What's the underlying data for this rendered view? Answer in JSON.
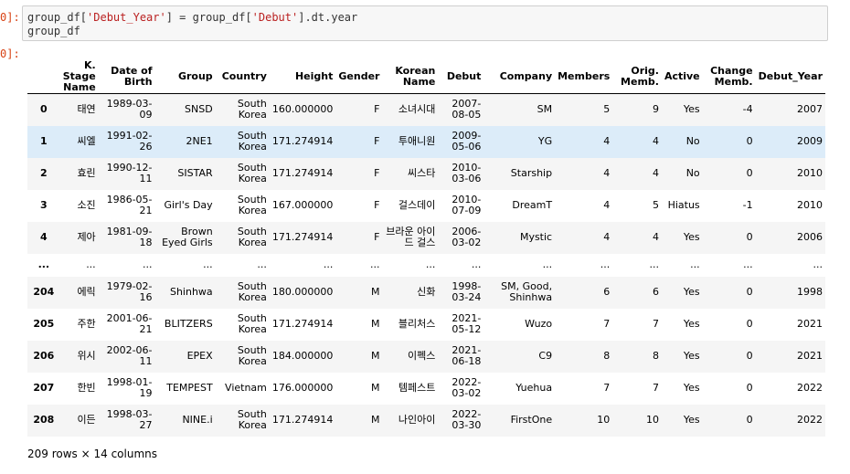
{
  "prompts": {
    "input": "0]:",
    "output": "0]:"
  },
  "code": {
    "line1": {
      "a": "group_df[",
      "s1": "'Debut_Year'",
      "b": "] = group_df[",
      "s2": "'Debut'",
      "c": "].dt.year"
    },
    "line2": "group_df"
  },
  "table": {
    "columns": [
      "",
      "K. Stage Name",
      "Date of Birth",
      "Group",
      "Country",
      "Height",
      "Gender",
      "Korean Name",
      "Debut",
      "Company",
      "Members",
      "Orig. Memb.",
      "Active",
      "Change Memb.",
      "Debut_Year"
    ],
    "rows": [
      [
        "0",
        "태연",
        "1989-03-09",
        "SNSD",
        "South Korea",
        "160.000000",
        "F",
        "소녀시대",
        "2007-08-05",
        "SM",
        "5",
        "9",
        "Yes",
        "-4",
        "2007"
      ],
      [
        "1",
        "씨엘",
        "1991-02-26",
        "2NE1",
        "South Korea",
        "171.274914",
        "F",
        "투애니원",
        "2009-05-06",
        "YG",
        "4",
        "4",
        "No",
        "0",
        "2009"
      ],
      [
        "2",
        "효린",
        "1990-12-11",
        "SISTAR",
        "South Korea",
        "171.274914",
        "F",
        "씨스타",
        "2010-03-06",
        "Starship",
        "4",
        "4",
        "No",
        "0",
        "2010"
      ],
      [
        "3",
        "소진",
        "1986-05-21",
        "Girl's Day",
        "South Korea",
        "167.000000",
        "F",
        "걸스데이",
        "2010-07-09",
        "DreamT",
        "4",
        "5",
        "Hiatus",
        "-1",
        "2010"
      ],
      [
        "4",
        "제아",
        "1981-09-18",
        "Brown Eyed Girls",
        "South Korea",
        "171.274914",
        "F",
        "브라운 아이드 걸스",
        "2006-03-02",
        "Mystic",
        "4",
        "4",
        "Yes",
        "0",
        "2006"
      ],
      [
        "...",
        "...",
        "...",
        "...",
        "...",
        "...",
        "...",
        "...",
        "...",
        "...",
        "...",
        "...",
        "...",
        "...",
        "..."
      ],
      [
        "204",
        "에릭",
        "1979-02-16",
        "Shinhwa",
        "South Korea",
        "180.000000",
        "M",
        "신화",
        "1998-03-24",
        "SM, Good, Shinhwa",
        "6",
        "6",
        "Yes",
        "0",
        "1998"
      ],
      [
        "205",
        "주한",
        "2001-06-21",
        "BLITZERS",
        "South Korea",
        "171.274914",
        "M",
        "블리처스",
        "2021-05-12",
        "Wuzo",
        "7",
        "7",
        "Yes",
        "0",
        "2021"
      ],
      [
        "206",
        "위시",
        "2002-06-11",
        "EPEX",
        "South Korea",
        "184.000000",
        "M",
        "이펙스",
        "2021-06-18",
        "C9",
        "8",
        "8",
        "Yes",
        "0",
        "2021"
      ],
      [
        "207",
        "한빈",
        "1998-01-19",
        "TEMPEST",
        "Vietnam",
        "176.000000",
        "M",
        "템페스트",
        "2022-03-02",
        "Yuehua",
        "7",
        "7",
        "Yes",
        "0",
        "2022"
      ],
      [
        "208",
        "이든",
        "1998-03-27",
        "NINE.i",
        "South Korea",
        "171.274914",
        "M",
        "나인아이",
        "2022-03-30",
        "FirstOne",
        "10",
        "10",
        "Yes",
        "0",
        "2022"
      ]
    ],
    "highlighted_row": 1
  },
  "footer": "209 rows × 14 columns",
  "colors": {
    "prompt": "#d84315",
    "string": "#ba2121",
    "highlight": "#dcecf9",
    "stripe": "#f5f5f5"
  }
}
